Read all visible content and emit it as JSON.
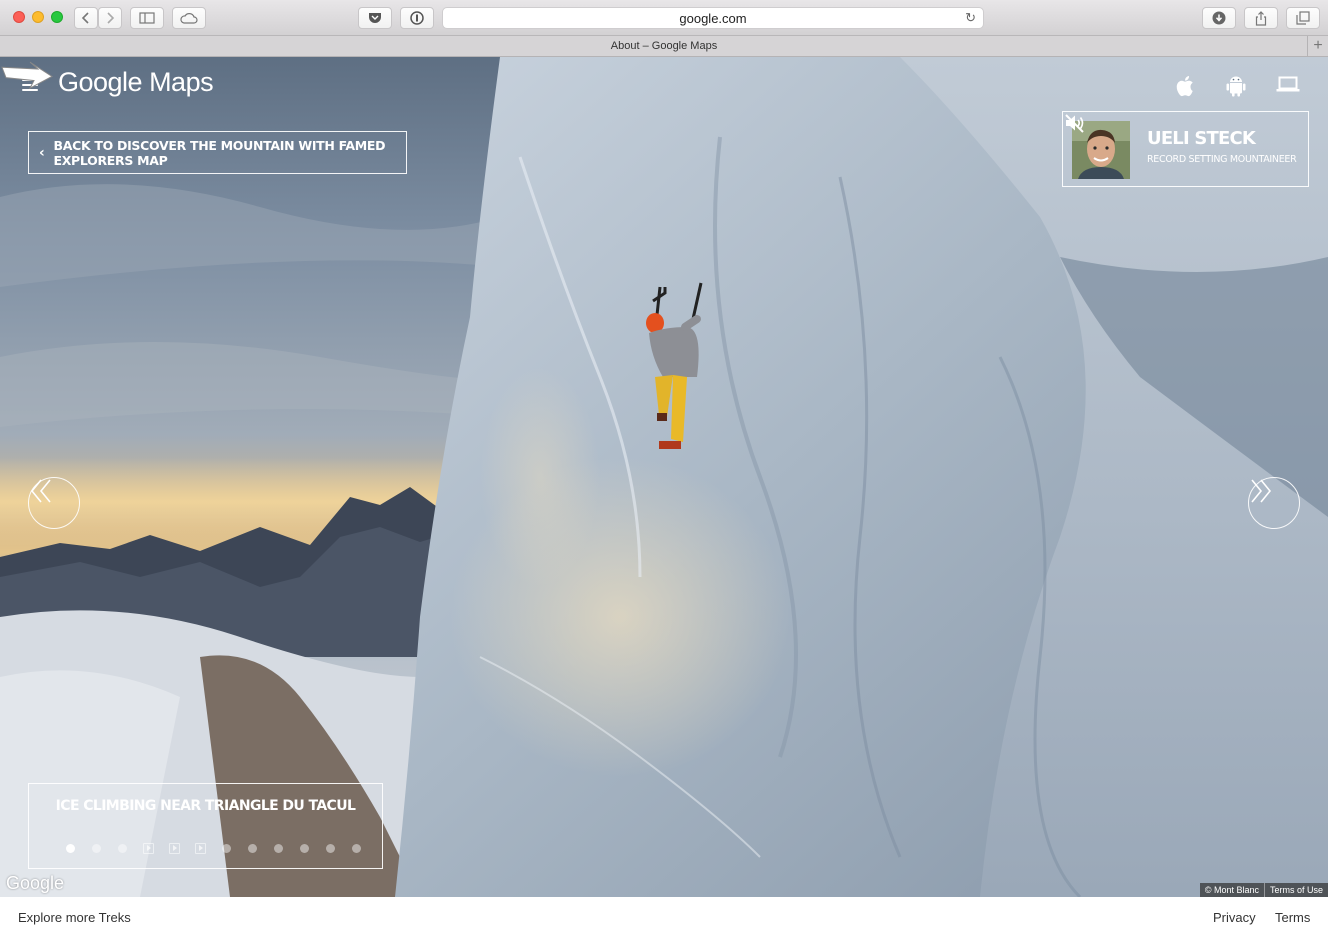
{
  "browser": {
    "url": "google.com",
    "tab_title": "About – Google Maps"
  },
  "header": {
    "logo": "Google Maps"
  },
  "back_button": {
    "label": "BACK TO DISCOVER THE MOUNTAIN WITH FAMED EXPLORERS MAP"
  },
  "profile": {
    "name": "UELI STECK",
    "role": "RECORD SETTING MOUNTAINEER"
  },
  "caption": {
    "title": "ICE CLIMBING NEAR TRIANGLE DU TACUL",
    "active_index": 0,
    "items": [
      "dot",
      "dot",
      "dot",
      "video",
      "video",
      "video",
      "dot",
      "dot",
      "dot",
      "dot",
      "dot",
      "dot"
    ]
  },
  "map": {
    "watermark": "Google",
    "copyright": "© Mont Blanc",
    "terms_of_use": "Terms of Use"
  },
  "footer": {
    "explore": "Explore more Treks",
    "privacy": "Privacy",
    "terms": "Terms"
  },
  "icons": {
    "platforms": [
      "apple-icon",
      "android-icon",
      "laptop-icon"
    ],
    "mute": "volume-muted-icon"
  }
}
